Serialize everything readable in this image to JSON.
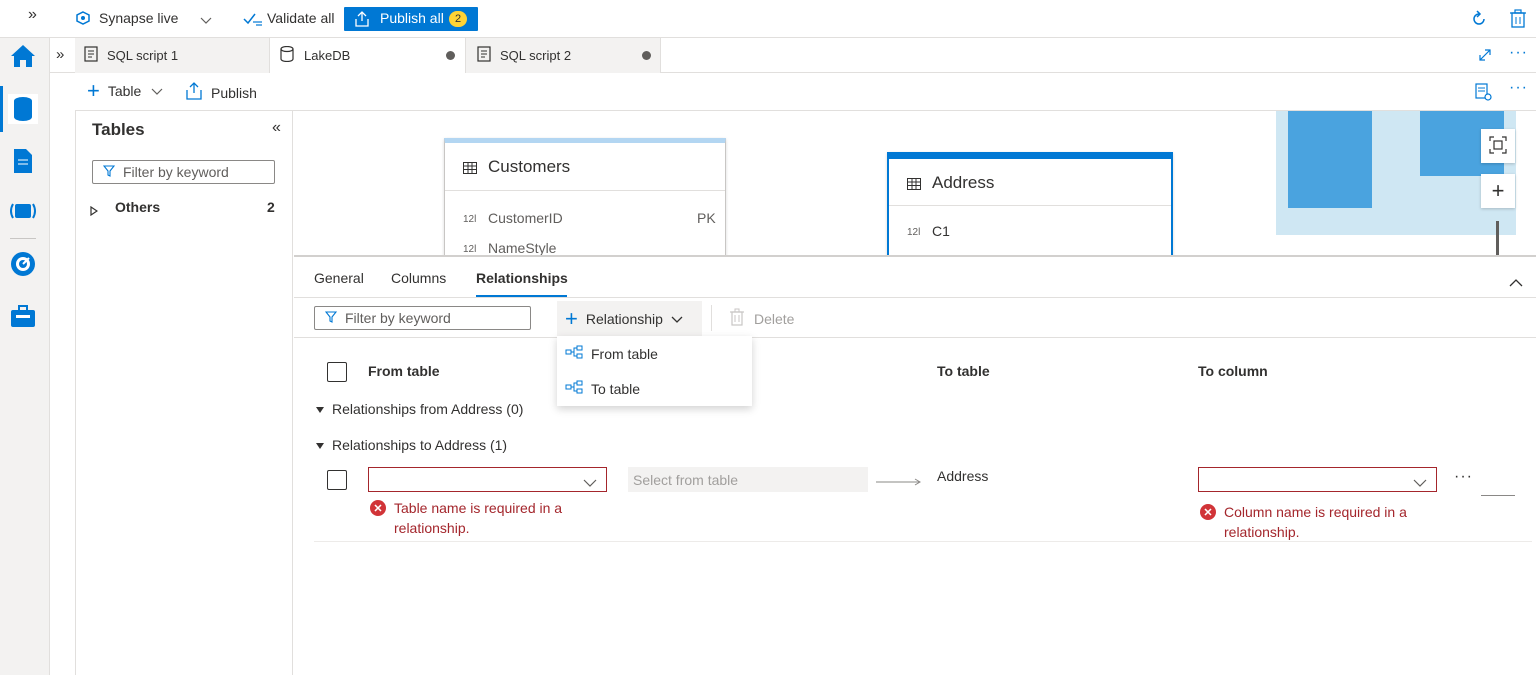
{
  "topbar": {
    "workspace": "Synapse live",
    "validate_all": "Validate all",
    "publish_all": "Publish all",
    "publish_count": "2"
  },
  "tabs": [
    {
      "label": "SQL script 1"
    },
    {
      "label": "LakeDB"
    },
    {
      "label": "SQL script 2"
    }
  ],
  "toolbar": {
    "table": "Table",
    "publish": "Publish"
  },
  "tables_panel": {
    "title": "Tables",
    "filter_placeholder": "Filter by keyword",
    "group_label": "Others",
    "group_count": "2"
  },
  "canvas": {
    "customers": {
      "title": "Customers",
      "rows": [
        {
          "type": "12l",
          "name": "CustomerID",
          "key": "PK"
        },
        {
          "type": "12l",
          "name": "NameStyle",
          "key": ""
        }
      ]
    },
    "address": {
      "title": "Address",
      "rows": [
        {
          "type": "12l",
          "name": "C1"
        }
      ]
    }
  },
  "details": {
    "tabs": [
      "General",
      "Columns",
      "Relationships"
    ],
    "active_tab": "Relationships",
    "filter_placeholder": "Filter by keyword",
    "relationship_button": "Relationship",
    "delete_button": "Delete",
    "menu": [
      "From table",
      "To table"
    ],
    "headers": {
      "from_table": "From table",
      "to_table": "To table",
      "to_column": "To column"
    },
    "group_from": "Relationships from Address (0)",
    "group_to": "Relationships to Address (1)",
    "row": {
      "from_column_placeholder": "Select from table",
      "to_table": "Address",
      "from_table_error": "Table name is required in a relationship.",
      "to_column_error": "Column name is required in a relationship."
    }
  },
  "colors": {
    "accent": "#0078d4",
    "error": "#a4262c",
    "badge": "#ffd335"
  }
}
